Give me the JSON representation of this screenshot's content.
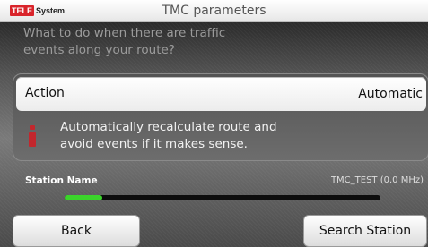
{
  "header": {
    "brand": {
      "badge": "TELE",
      "suffix": "System"
    },
    "title": "TMC parameters"
  },
  "prompt": {
    "line1": "What to do when there are traffic",
    "line2": "events along your route?"
  },
  "action": {
    "label": "Action",
    "value": "Automatic",
    "description_line1": "Automatically recalculate route and",
    "description_line2": "avoid events if it makes sense."
  },
  "station": {
    "label": "Station Name",
    "value": "TMC_TEST (0.0 MHz)",
    "signal_level_percent": 12
  },
  "buttons": {
    "back": "Back",
    "search": "Search Station"
  },
  "colors": {
    "accent_red": "#c2272d",
    "signal_green": "#3bd42b"
  },
  "icons": {
    "info": "info-icon"
  }
}
